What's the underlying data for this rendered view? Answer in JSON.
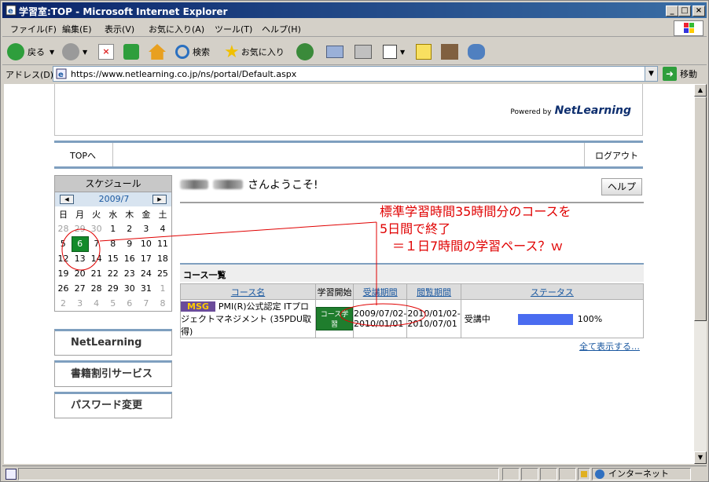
{
  "window": {
    "title": "学習室:TOP - Microsoft Internet Explorer"
  },
  "menu": [
    "ファイル(F)",
    "編集(E)",
    "表示(V)",
    "お気に入り(A)",
    "ツール(T)",
    "ヘルプ(H)"
  ],
  "toolbar": {
    "back": "戻る",
    "search": "検索",
    "favorites": "お気に入り"
  },
  "address": {
    "label": "アドレス(D)",
    "url": "https://www.netlearning.co.jp/ns/portal/Default.aspx",
    "go": "移動"
  },
  "page": {
    "powered_by": "Powered by",
    "logo": "NetLearning",
    "nav": {
      "top": "TOPへ",
      "logout": "ログアウト"
    },
    "schedule": {
      "title": "スケジュール",
      "month": "2009/7",
      "weekdays": [
        "日",
        "月",
        "火",
        "水",
        "木",
        "金",
        "土"
      ],
      "weeks": [
        [
          "28",
          "29",
          "30",
          "1",
          "2",
          "3",
          "4"
        ],
        [
          "5",
          "6",
          "7",
          "8",
          "9",
          "10",
          "11"
        ],
        [
          "12",
          "13",
          "14",
          "15",
          "16",
          "17",
          "18"
        ],
        [
          "19",
          "20",
          "21",
          "22",
          "23",
          "24",
          "25"
        ],
        [
          "26",
          "27",
          "28",
          "29",
          "30",
          "31",
          "1"
        ],
        [
          "2",
          "3",
          "4",
          "5",
          "6",
          "7",
          "8"
        ]
      ],
      "today": "6"
    },
    "side_buttons": [
      "NetLearning",
      "書籍割引サービス",
      "パスワード変更"
    ],
    "welcome": "さんようこそ!",
    "help": "ヘルプ",
    "annotation": "標準学習時間35時間分のコースを\n5日間で終了\n　＝１日7時間の学習ペース？ｗ",
    "course_list": {
      "title": "コース一覧",
      "headers": [
        "コース名",
        "学習開始",
        "受講期間",
        "閲覧期間",
        "ステータス"
      ],
      "row": {
        "badge": "MSG",
        "name": "PMI(R)公式認定 ITプロジェクトマネジメント (35PDU取得)",
        "start_button": "コース学習",
        "period": "2009/07/02-2010/01/01",
        "view_period": "2010/01/02-2010/07/01",
        "status": "受講中",
        "progress_label": "100%",
        "progress": 1.0
      },
      "show_all": "全て表示する…"
    }
  },
  "status": {
    "zone": "インターネット"
  }
}
